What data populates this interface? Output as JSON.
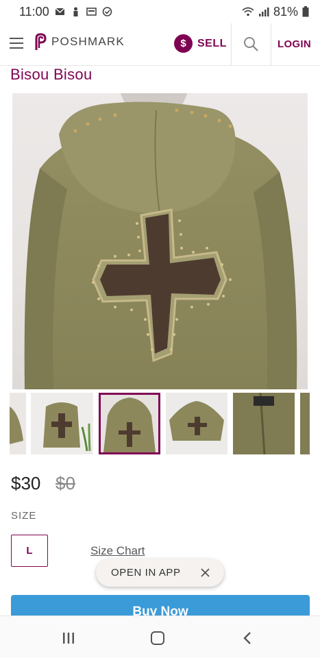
{
  "status_bar": {
    "time": "11:00",
    "battery": "81%"
  },
  "header": {
    "logo_text": "POSHMARK",
    "sell_symbol": "$",
    "sell_label": "SELL",
    "login_label": "LOGIN"
  },
  "listing": {
    "brand": "Bisou Bisou",
    "price": "$30",
    "original_price": "$0",
    "size_heading": "SIZE",
    "size_value": "L",
    "size_chart_label": "Size Chart",
    "selected_thumbnail_index": 2
  },
  "open_in_app": {
    "label": "OPEN IN APP"
  },
  "buy_now": {
    "label": "Buy Now"
  },
  "colors": {
    "brand": "#7f0353",
    "buy_button": "#3b9ad8",
    "jacket": "#8e8a5e",
    "cross": "#4e3b30"
  }
}
